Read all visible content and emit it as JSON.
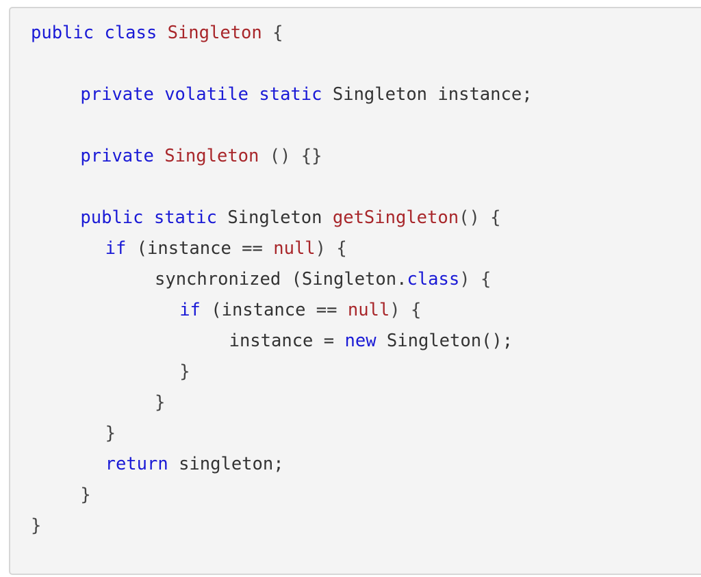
{
  "code_lines": [
    {
      "indent": 0,
      "tokens": [
        [
          "kw",
          "public class "
        ],
        [
          "name",
          "Singleton"
        ],
        [
          "punct",
          " {"
        ]
      ]
    },
    {
      "indent": 0,
      "tokens": []
    },
    {
      "indent": 4,
      "tokens": [
        [
          "kw",
          "private volatile static "
        ],
        [
          "plain",
          "Singleton instance;"
        ]
      ]
    },
    {
      "indent": 0,
      "tokens": []
    },
    {
      "indent": 4,
      "tokens": [
        [
          "kw",
          "private "
        ],
        [
          "name",
          "Singleton"
        ],
        [
          "punct",
          " () {}"
        ]
      ]
    },
    {
      "indent": 0,
      "tokens": []
    },
    {
      "indent": 4,
      "tokens": [
        [
          "kw",
          "public static "
        ],
        [
          "plain",
          "Singleton "
        ],
        [
          "name",
          "getSingleton"
        ],
        [
          "punct",
          "() {"
        ]
      ]
    },
    {
      "indent": 6,
      "tokens": [
        [
          "kw",
          "if "
        ],
        [
          "plain",
          "(instance == "
        ],
        [
          "lit",
          "null"
        ],
        [
          "punct",
          ") {"
        ]
      ]
    },
    {
      "indent": 10,
      "tokens": [
        [
          "plain",
          "synchronized (Singleton."
        ],
        [
          "kw",
          "class"
        ],
        [
          "punct",
          ") {"
        ]
      ]
    },
    {
      "indent": 12,
      "tokens": [
        [
          "kw",
          "if "
        ],
        [
          "plain",
          "(instance == "
        ],
        [
          "lit",
          "null"
        ],
        [
          "punct",
          ") {"
        ]
      ]
    },
    {
      "indent": 16,
      "tokens": [
        [
          "plain",
          "instance = "
        ],
        [
          "kw",
          "new "
        ],
        [
          "plain",
          "Singleton();"
        ]
      ]
    },
    {
      "indent": 12,
      "tokens": [
        [
          "punct",
          "}"
        ]
      ]
    },
    {
      "indent": 10,
      "tokens": [
        [
          "punct",
          "}"
        ]
      ]
    },
    {
      "indent": 6,
      "tokens": [
        [
          "punct",
          "}"
        ]
      ]
    },
    {
      "indent": 6,
      "tokens": [
        [
          "kw",
          "return "
        ],
        [
          "plain",
          "singleton;"
        ]
      ]
    },
    {
      "indent": 4,
      "tokens": [
        [
          "punct",
          "}"
        ]
      ]
    },
    {
      "indent": 0,
      "tokens": [
        [
          "punct",
          "}"
        ]
      ]
    }
  ]
}
